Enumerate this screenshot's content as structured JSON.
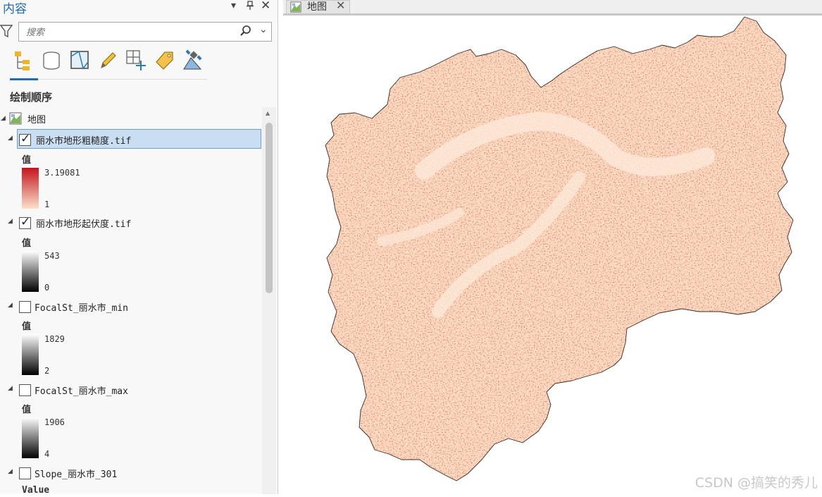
{
  "pane": {
    "title": "内容",
    "search_placeholder": "搜索",
    "toolbar": [
      "list-by-drawing-order",
      "list-by-source",
      "list-by-selection",
      "list-by-editing",
      "list-by-snapping",
      "list-by-labeling",
      "list-by-perspective-imagery"
    ],
    "section_title": "绘制顺序"
  },
  "tree": {
    "map_name": "地图",
    "layers": [
      {
        "name": "丽水市地形粗糙度.tif",
        "checked": true,
        "selected": true,
        "legend_title": "值",
        "high": "3.19081",
        "low": "1",
        "ramp": [
          "#c4141c",
          "#fbe0cc"
        ]
      },
      {
        "name": "丽水市地形起伏度.tif",
        "checked": true,
        "selected": false,
        "legend_title": "值",
        "high": "543",
        "low": "0",
        "ramp": [
          "#ffffff",
          "#000000"
        ]
      },
      {
        "name": "FocalSt_丽水市_min",
        "checked": false,
        "selected": false,
        "legend_title": "值",
        "high": "1829",
        "low": "2",
        "ramp": [
          "#ffffff",
          "#000000"
        ]
      },
      {
        "name": "FocalSt_丽水市_max",
        "checked": false,
        "selected": false,
        "legend_title": "值",
        "high": "1906",
        "low": "4",
        "ramp": [
          "#ffffff",
          "#000000"
        ]
      },
      {
        "name": "Slope_丽水市_301",
        "checked": false,
        "selected": false,
        "legend_title": "Value",
        "high": "",
        "low": "",
        "ramp": [
          "#ffffff",
          "#000000"
        ]
      }
    ]
  },
  "map_view": {
    "tab_label": "地图",
    "fill_color": "#fbdcc4",
    "texture_color": "#c5331f",
    "watermark": "CSDN @搞笑的秀儿"
  }
}
